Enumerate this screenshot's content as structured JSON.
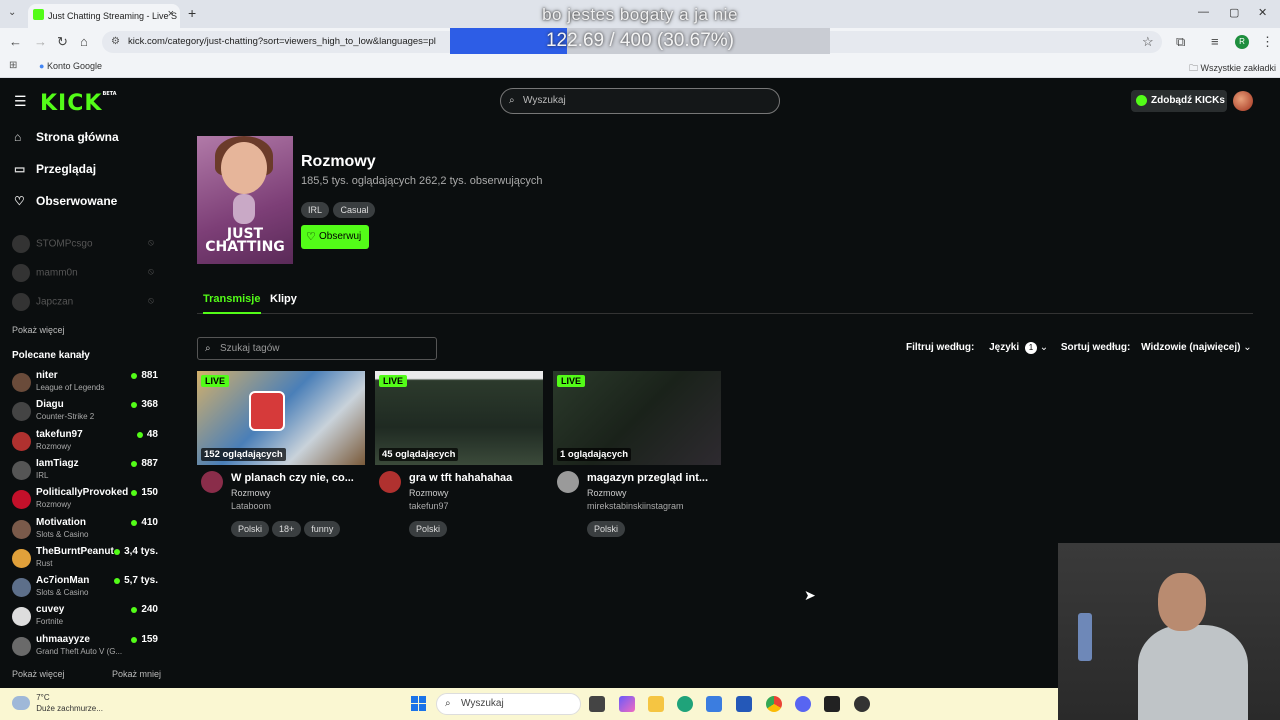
{
  "browser": {
    "tab_title": "Just Chatting Streaming - Live S",
    "url": "kick.com/category/just-chatting?sort=viewers_high_to_low&languages=pl",
    "bookmark": "Konto Google",
    "all_bookmarks": "Wszystkie zakładki",
    "profile_initial": "R"
  },
  "overlay": {
    "caption": "bo jestes bogaty a ja nie",
    "progress_label": "122.69 / 400 (30.67%)",
    "progress_fraction": 0.3067,
    "progress_color": "#2d5de6"
  },
  "kick": {
    "logo": "KICK",
    "logo_badge": "BETA",
    "search_placeholder": "Wyszukaj",
    "kicks_button": "Zdobądź KICKs",
    "accent": "#53fc18"
  },
  "sidebar": {
    "nav": [
      {
        "label": "Strona główna",
        "icon": "home-icon"
      },
      {
        "label": "Przeglądaj",
        "icon": "browse-icon"
      },
      {
        "label": "Obserwowane",
        "icon": "heart-icon"
      }
    ],
    "offline": [
      {
        "name": "STOMPcsgo"
      },
      {
        "name": "mamm0n"
      },
      {
        "name": "Japczan"
      }
    ],
    "show_more_1": "Pokaż więcej",
    "recommended_title": "Polecane kanały",
    "recommended": [
      {
        "name": "niter",
        "category": "League of Legends",
        "viewers": "881",
        "color": "#6a4b3a"
      },
      {
        "name": "Diagu",
        "category": "Counter-Strike 2",
        "viewers": "368",
        "color": "#444"
      },
      {
        "name": "takefun97",
        "category": "Rozmowy",
        "viewers": "48",
        "color": "#b0312f"
      },
      {
        "name": "IamTiagz",
        "category": "IRL",
        "viewers": "887",
        "color": "#555"
      },
      {
        "name": "PoliticallyProvoked",
        "category": "Rozmowy",
        "viewers": "150",
        "color": "#c3102a"
      },
      {
        "name": "Motivation",
        "category": "Slots & Casino",
        "viewers": "410",
        "color": "#7a5a4a"
      },
      {
        "name": "TheBurntPeanut",
        "category": "Rust",
        "viewers": "3,4 tys.",
        "color": "#e0a03a"
      },
      {
        "name": "Ac7ionMan",
        "category": "Slots & Casino",
        "viewers": "5,7 tys.",
        "color": "#5d6f8a"
      },
      {
        "name": "cuvey",
        "category": "Fortnite",
        "viewers": "240",
        "color": "#ddd"
      },
      {
        "name": "uhmaayyze",
        "category": "Grand Theft Auto V (G...",
        "viewers": "159",
        "color": "#6a6a6a"
      }
    ],
    "show_more_2": "Pokaż więcej",
    "show_less": "Pokaż mniej"
  },
  "category": {
    "image_text": "JUST CHATTING",
    "title": "Rozmowy",
    "stats": "185,5 tys. oglądających  262,2 tys. obserwujących",
    "tags": [
      "IRL",
      "Casual"
    ],
    "follow_label": "Obserwuj",
    "tabs": [
      "Transmisje",
      "Klipy"
    ]
  },
  "filters": {
    "tag_search_placeholder": "Szukaj tagów",
    "filter_label": "Filtruj według:",
    "languages_label": "Języki",
    "languages_count": "1",
    "sort_label": "Sortuj według:",
    "sort_value": "Widzowie (najwięcej)"
  },
  "streams": [
    {
      "title": "W planach czy nie, co...",
      "category": "Rozmowy",
      "user": "Lataboom",
      "viewers": "152 oglądających",
      "tags": [
        "Polski",
        "18+",
        "funny"
      ],
      "live": "LIVE"
    },
    {
      "title": "gra w tft hahahahaa",
      "category": "Rozmowy",
      "user": "takefun97",
      "viewers": "45 oglądających",
      "tags": [
        "Polski"
      ],
      "live": "LIVE"
    },
    {
      "title": "magazyn przegląd int...",
      "category": "Rozmowy",
      "user": "mirekstabinskiinstagram",
      "viewers": "1 oglądających",
      "tags": [
        "Polski"
      ],
      "live": "LIVE"
    }
  ],
  "taskbar": {
    "temp": "7°C",
    "weather": "Duże zachmurze...",
    "search": "Wyszukaj"
  }
}
